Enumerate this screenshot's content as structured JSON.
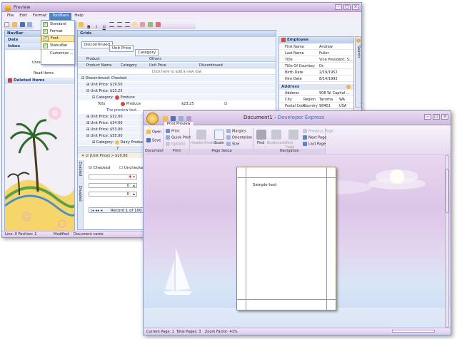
{
  "win1": {
    "title": "Preview",
    "menu": [
      "File",
      "Edit",
      "Format",
      "ToolBars",
      "Help"
    ],
    "toolbars_menu": {
      "items": [
        "Standard",
        "Format",
        "Font",
        "StatusBar",
        "Customize ..."
      ],
      "selected_index": 2
    },
    "navbar": {
      "title": "NavBar",
      "items": [
        "Date",
        "Inbox"
      ],
      "unread_label": "Unrea",
      "read_label": "Read Items",
      "deleted_label": "Deleted Items"
    },
    "grids": {
      "title": "Grids",
      "filter_tags": [
        "Discontinued",
        "Unit Price",
        "Category"
      ],
      "band_headers": [
        "Product",
        "Others"
      ],
      "columns": [
        "Product Name",
        "Category",
        "Unit Price",
        "Discontinued"
      ],
      "new_row_text": "Click here to add a new row",
      "groups": [
        {
          "label": "Discontinued: Checked",
          "indent": 1
        },
        {
          "label": "Unit Price: $19.50",
          "indent": 2
        },
        {
          "label": "Unit Price: $23.25",
          "indent": 2
        },
        {
          "label": "Category:",
          "value": "Produce",
          "indent": 3
        }
      ],
      "data_row": {
        "name": "Tofu",
        "category": "Produce",
        "price": "$23.25"
      },
      "preview_text": "The preview text...",
      "more_groups": [
        "Unit Price: $32.00",
        "Unit Price: $34.00",
        "Unit Price: $53.00",
        "Unit Price: $55.00"
      ],
      "last_group": {
        "label": "Category:",
        "value": "Dairy Products"
      },
      "summary_value": "7",
      "filter_text": "[Unit Price] > $10.00",
      "tabs": [
        "Enabled",
        "Disabled"
      ],
      "checked_label": "Checked",
      "unchecked_label": "Unchecked",
      "spin_values": [
        "0",
        "0"
      ],
      "record_text": "Record 1 of 100"
    },
    "employee": {
      "title": "Employee",
      "fields": [
        {
          "label": "First Name",
          "value": "Andrew"
        },
        {
          "label": "Last Name",
          "value": "Fuller"
        },
        {
          "label": "Title",
          "value": "Vice President, S..."
        },
        {
          "label": "Title Of Courtesy",
          "value": "Dr."
        },
        {
          "label": "Birth Date",
          "value": "2/19/1952"
        },
        {
          "label": "Hire Date",
          "value": "8/14/1992"
        }
      ],
      "address_title": "Address",
      "address_fields": [
        {
          "label": "Address",
          "value": "908 W. Capital ..."
        },
        {
          "label": "City",
          "sublabel": "Region",
          "value": "Tacoma",
          "extra_label": "WA"
        },
        {
          "label": "Postal Code",
          "sublabel": "Country",
          "value": "98401",
          "extra_label": "USA"
        },
        {
          "label": "Home Phone",
          "value": "(206) 555-9482"
        },
        {
          "label": "Extension",
          "value": "3457"
        }
      ],
      "side_label": "Search"
    },
    "status": [
      "Line: 0 Position: 1",
      "Modified",
      "Document name"
    ]
  },
  "win2": {
    "title": "Document1",
    "app_name": "Developer Express",
    "separator": " - ",
    "tab": "Print Preview",
    "groups": {
      "document": {
        "label": "Document",
        "items": [
          "Open",
          "Save"
        ]
      },
      "print": {
        "label": "Print",
        "items": [
          "Print",
          "Quick Print",
          "Options"
        ]
      },
      "page_setup": {
        "label": "Page Setup",
        "items": [
          "Header/Footer",
          "Scale",
          "Margins",
          "Orientation",
          "Size"
        ]
      },
      "navigation": {
        "label": "Navigation",
        "items": [
          "Find",
          "Bookmarks",
          "First Page",
          "Previous Page",
          "Next Page",
          "Last Page"
        ]
      }
    },
    "page_text": "Sample text",
    "status": [
      "Current Page: 1",
      "Total Pages: 3",
      "Zoom Factor: 41%"
    ]
  },
  "colors": {
    "accent": "#4a86c8",
    "ribbon_bg": "#e7dcf1",
    "preview_bg": "#dcc6e8",
    "highlight": "#ffe8a8"
  }
}
